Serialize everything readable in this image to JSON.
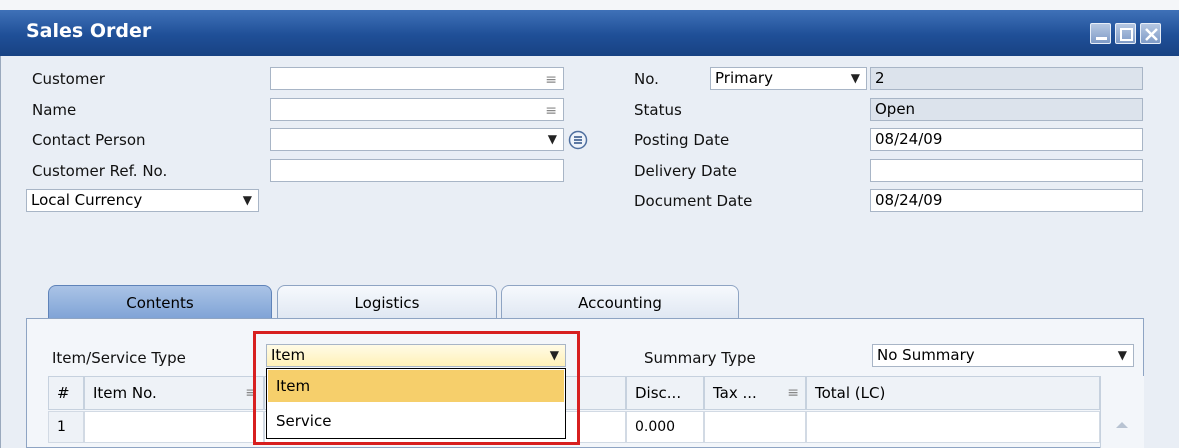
{
  "window": {
    "title": "Sales Order"
  },
  "header": {
    "customer_label": "Customer",
    "name_label": "Name",
    "contact_label": "Contact Person",
    "ref_label": "Customer Ref. No.",
    "currency_value": "Local Currency",
    "no_label": "No.",
    "series_value": "Primary",
    "no_value": "2",
    "status_label": "Status",
    "status_value": "Open",
    "posting_label": "Posting Date",
    "posting_value": "08/24/09",
    "delivery_label": "Delivery Date",
    "delivery_value": "",
    "document_label": "Document Date",
    "document_value": "08/24/09"
  },
  "tabs": [
    {
      "label": "Contents"
    },
    {
      "label": "Logistics"
    },
    {
      "label": "Accounting"
    }
  ],
  "contents": {
    "type_label": "Item/Service Type",
    "type_value": "Item",
    "summary_label": "Summary Type",
    "summary_value": "No Summary",
    "columns": {
      "num": "#",
      "item_no": "Item No.",
      "disc": "Disc...",
      "tax": "Tax ...",
      "total": "Total (LC)"
    },
    "row": {
      "num": "1",
      "disc": "0.000"
    },
    "dropdown_options": [
      "Item",
      "Service"
    ]
  },
  "colors": {
    "title_bar": "#1f4f97",
    "highlight": "#d71f1f",
    "selected_option": "#f6cf6b"
  }
}
